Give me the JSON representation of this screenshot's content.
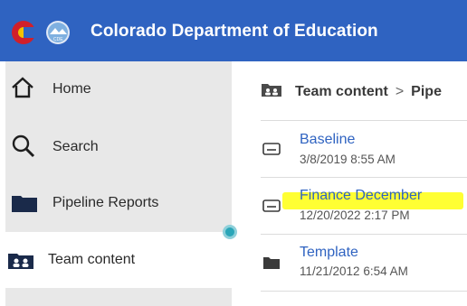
{
  "header": {
    "title": "Colorado Department of Education",
    "logo_icon": "colorado-flag-logo",
    "brand_color": "#2f63c1"
  },
  "sidebar": {
    "items": [
      {
        "label": "Home",
        "icon": "home-icon"
      },
      {
        "label": "Search",
        "icon": "search-icon"
      },
      {
        "label": "Pipeline Reports",
        "icon": "folder-icon"
      },
      {
        "label": "Team content",
        "icon": "team-folder-icon",
        "selected": true
      }
    ]
  },
  "main": {
    "breadcrumb": {
      "root": "Team content",
      "separator": ">",
      "current": "Pipe"
    },
    "files": [
      {
        "name": "Baseline",
        "date": "3/8/2019 8:55 AM",
        "icon": "report-icon"
      },
      {
        "name": "Finance December",
        "date": "12/20/2022 2:17 PM",
        "icon": "report-icon",
        "highlight_color": "#ffff33"
      },
      {
        "name": "Template",
        "date": "11/21/2012 6:54 AM",
        "icon": "folder-icon"
      }
    ]
  }
}
